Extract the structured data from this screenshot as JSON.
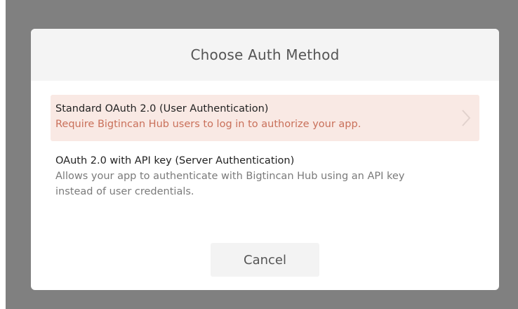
{
  "dialog": {
    "title": "Choose Auth Method",
    "options": [
      {
        "title": "Standard OAuth 2.0 (User Authentication)",
        "description": "Require Bigtincan Hub users to log in to authorize your app.",
        "selected": true
      },
      {
        "title": "OAuth 2.0 with API key (Server Authentication)",
        "description": "Allows your app to authenticate with Bigtincan Hub using an API key instead of user credentials.",
        "selected": false
      }
    ],
    "cancel_label": "Cancel"
  },
  "colors": {
    "backdrop": "#808080",
    "header_bg": "#f4f4f4",
    "selected_bg": "#f9e9e4",
    "selected_text": "#c9705a",
    "button_bg": "#f3f3f3"
  },
  "icons": {
    "selected_option_arrow": "chevron-right-icon"
  }
}
